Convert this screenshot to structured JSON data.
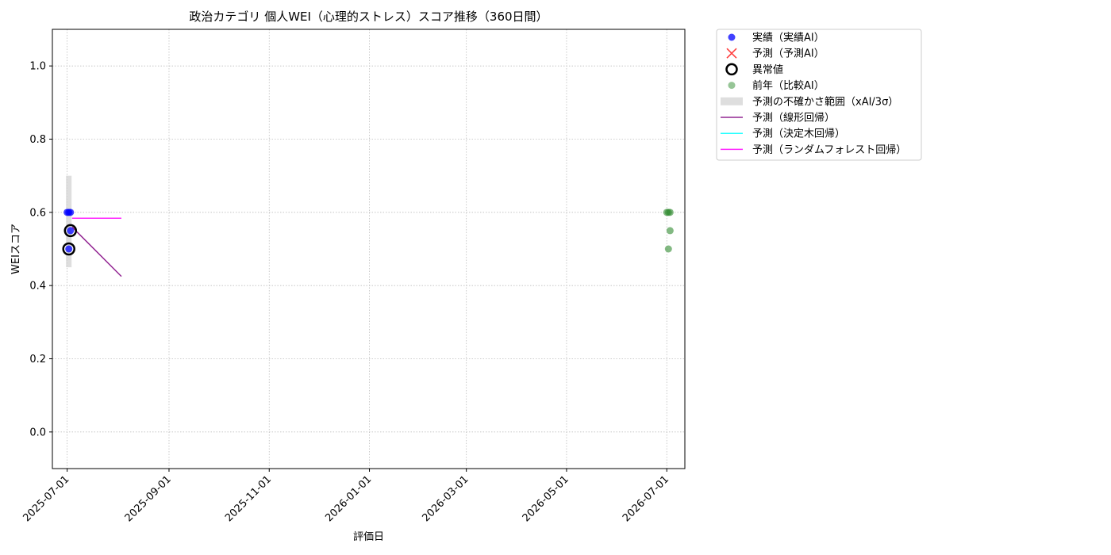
{
  "chart_data": {
    "type": "scatter",
    "title": "政治カテゴリ 個人WEI（心理的ストレス）スコア推移（360日間）",
    "xlabel": "評価日",
    "ylabel": "WEIスコア",
    "x_type": "date",
    "xlim": [
      "2025-06-22",
      "2026-07-12"
    ],
    "ylim": [
      -0.1,
      1.1
    ],
    "x_ticks": [
      "2025-07-01",
      "2025-09-01",
      "2025-11-01",
      "2026-01-01",
      "2026-03-01",
      "2026-05-01",
      "2026-07-01"
    ],
    "y_ticks": [
      "0.0",
      "0.2",
      "0.4",
      "0.6",
      "0.8",
      "1.0"
    ],
    "grid": true,
    "legend_position": "outside-right-top",
    "legend": [
      {
        "key": "actual",
        "label": "実績（実績AI）",
        "marker": "dot",
        "color": "#0000ff"
      },
      {
        "key": "forecast",
        "label": "予測（予測AI）",
        "marker": "x",
        "color": "#ff0000"
      },
      {
        "key": "anomaly",
        "label": "異常値",
        "marker": "ring",
        "color": "#000000"
      },
      {
        "key": "prev",
        "label": "前年（比較AI）",
        "marker": "dot",
        "color": "#2e8b2e"
      },
      {
        "key": "band",
        "label": "予測の不確かさ範囲（xAI/3σ）",
        "marker": "band",
        "color": "#d3d3d3"
      },
      {
        "key": "linear",
        "label": "予測（線形回帰）",
        "marker": "line",
        "color": "#800080"
      },
      {
        "key": "tree",
        "label": "予測（決定木回帰）",
        "marker": "line",
        "color": "#00ffff"
      },
      {
        "key": "rf",
        "label": "予測（ランダムフォレスト回帰）",
        "marker": "line",
        "color": "#ff00ff"
      }
    ],
    "series": {
      "actual": [
        {
          "x": "2025-07-01",
          "y": 0.6
        },
        {
          "x": "2025-07-02",
          "y": 0.6
        },
        {
          "x": "2025-07-03",
          "y": 0.6
        },
        {
          "x": "2025-07-02",
          "y": 0.5
        },
        {
          "x": "2025-07-03",
          "y": 0.55
        }
      ],
      "anomaly": [
        {
          "x": "2025-07-02",
          "y": 0.5
        },
        {
          "x": "2025-07-03",
          "y": 0.55
        }
      ],
      "prev": [
        {
          "x": "2026-07-01",
          "y": 0.6
        },
        {
          "x": "2026-07-02",
          "y": 0.6
        },
        {
          "x": "2026-07-03",
          "y": 0.6
        },
        {
          "x": "2026-07-02",
          "y": 0.5
        },
        {
          "x": "2026-07-03",
          "y": 0.55
        }
      ],
      "band": {
        "x": "2025-07-02",
        "y_low": 0.45,
        "y_high": 0.7
      },
      "linear": [
        {
          "x": "2025-07-04",
          "y": 0.56
        },
        {
          "x": "2025-08-03",
          "y": 0.425
        }
      ],
      "rf": [
        {
          "x": "2025-07-04",
          "y": 0.584
        },
        {
          "x": "2025-08-03",
          "y": 0.584
        }
      ]
    }
  }
}
